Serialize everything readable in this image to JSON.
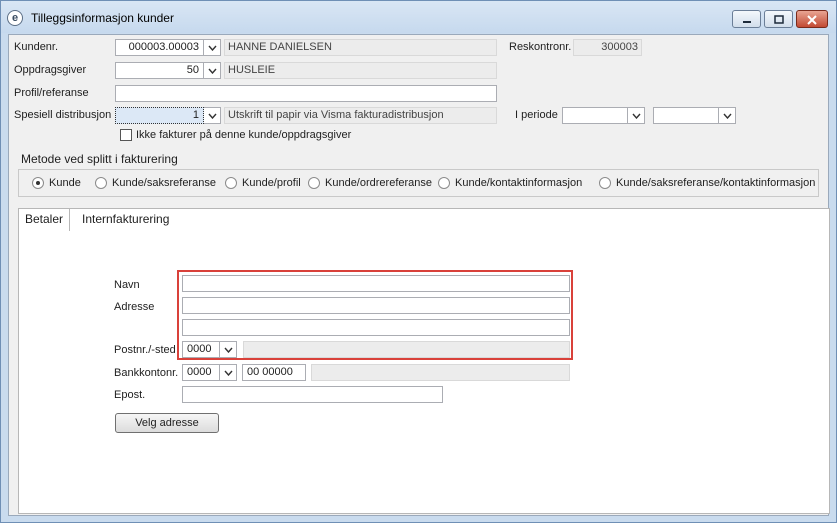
{
  "window": {
    "title": "Tilleggsinformasjon kunder",
    "app_icon": "e",
    "controls": {
      "minimize": "minimize-icon",
      "maximize": "maximize-icon",
      "close": "close-icon"
    }
  },
  "customer": {
    "kundenr_label": "Kundenr.",
    "kundenr_value": "000003.00003",
    "kunde_name": "HANNE DANIELSEN",
    "reskontronr_label": "Reskontronr.",
    "reskontronr_value": "300003",
    "oppdragsgiver_label": "Oppdragsgiver",
    "oppdragsgiver_value": "50",
    "oppdragsgiver_name": "HUSLEIE",
    "profil_label": "Profil/referanse",
    "profil_value": "",
    "distribusjon_label": "Spesiell distribusjon",
    "distribusjon_value": "1",
    "distribusjon_text": "Utskrift til papir via Visma fakturadistribusjon",
    "periode_label": "I periode",
    "periode_from": "",
    "periode_to": "",
    "ikke_fakturer_label": "Ikke fakturer på denne kunde/oppdragsgiver",
    "ikke_fakturer_checked": false
  },
  "split": {
    "title": "Metode ved splitt i fakturering",
    "options": [
      "Kunde",
      "Kunde/saksreferanse",
      "Kunde/profil",
      "Kunde/ordrereferanse",
      "Kunde/kontaktinformasjon",
      "Kunde/saksreferanse/kontaktinformasjon"
    ],
    "selected": "Kunde"
  },
  "tabs": {
    "items": [
      "Betaler",
      "Internfakturering"
    ],
    "active": "Betaler"
  },
  "payer": {
    "navn_label": "Navn",
    "navn_value": "",
    "adresse_label": "Adresse",
    "adresse1_value": "",
    "adresse2_value": "",
    "postnr_label": "Postnr./-sted",
    "postnr_value": "0000",
    "poststed_value": "",
    "bankkonto_label": "Bankkontonr.",
    "bankkonto_prefix": "0000",
    "bankkonto_number": "00 00000",
    "bankkonto_extra": "",
    "epost_label": "Epost.",
    "epost_value": "",
    "velg_adresse_label": "Velg adresse"
  },
  "colors": {
    "highlight": "#d9413a",
    "window_frame": "#c9dbee"
  }
}
